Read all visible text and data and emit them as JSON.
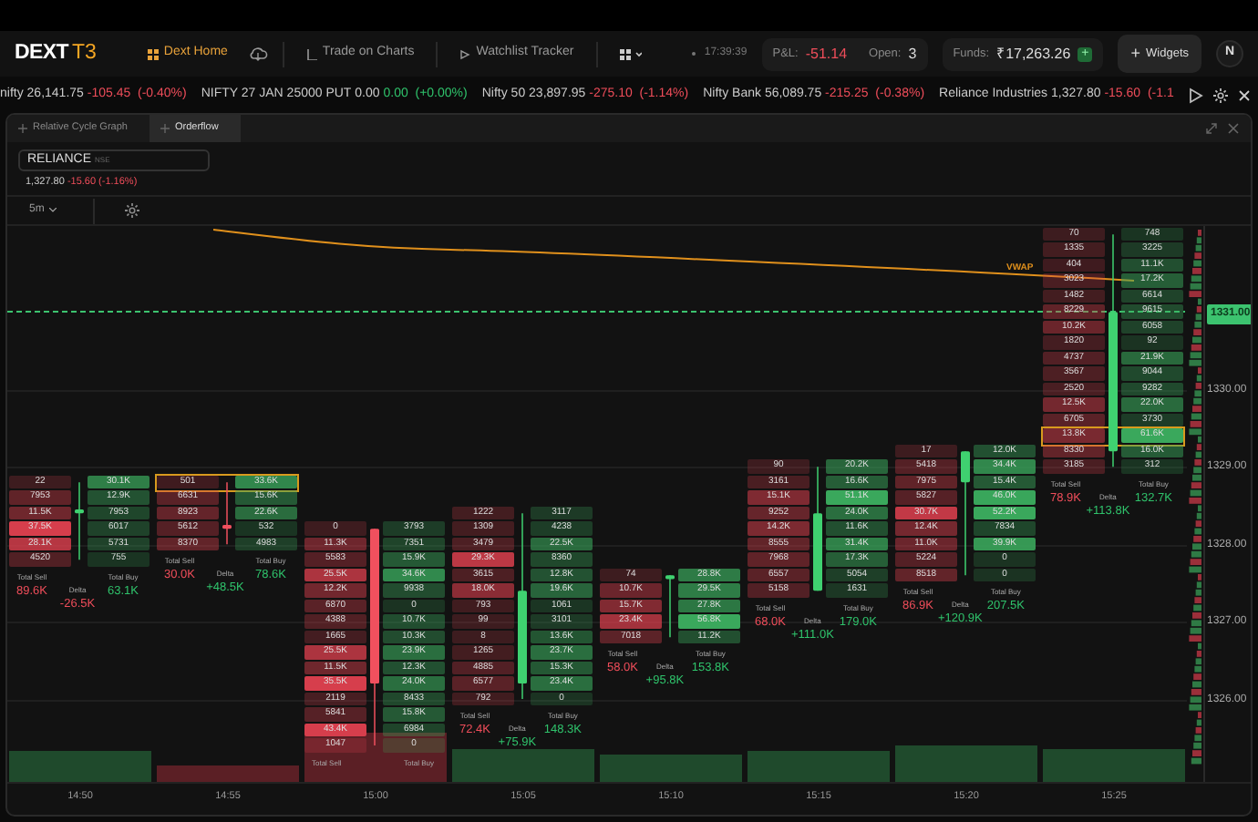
{
  "header": {
    "logo_main": "DEXT",
    "logo_sub": "T3",
    "nav": [
      {
        "label": "Dext Home",
        "selected": true
      },
      {
        "label": "Trade on Charts",
        "selected": false
      },
      {
        "label": "Watchlist Tracker",
        "selected": false
      }
    ],
    "clock": "17:39:39",
    "pnl_label": "P&L:",
    "pnl": "-51.14",
    "open_label": "Open:",
    "open": "3",
    "funds_label": "Funds:",
    "funds": "₹17,263.26",
    "add_funds": "+",
    "widgets_icon": "+",
    "widgets": "Widgets",
    "avatar": "N"
  },
  "ticker": [
    {
      "name": "nifty",
      "price": "26,141.75",
      "change": "-105.45",
      "percent": "(-0.40%)",
      "negative": true
    },
    {
      "name": "NIFTY 27 JAN 25000 PUT",
      "price": "0.00",
      "change": "0.00",
      "percent": "(+0.00%)",
      "negative": false
    },
    {
      "name": "Nifty 50",
      "price": "23,897.95",
      "change": "-275.10",
      "percent": "(-1.14%)",
      "negative": true
    },
    {
      "name": "Nifty Bank",
      "price": "56,089.75",
      "change": "-215.25",
      "percent": "(-0.38%)",
      "negative": true
    },
    {
      "name": "Reliance Industries",
      "price": "1,327.80",
      "change": "-15.60",
      "percent": "(-1.1",
      "negative": true
    }
  ],
  "panel": {
    "tabs": [
      {
        "label": "Relative Cycle Graph",
        "selected": false
      },
      {
        "label": "Orderflow",
        "selected": true
      }
    ],
    "symbol": "RELIANCE",
    "exchange": "NSE",
    "price": "1,327.80",
    "change": "-15.60",
    "percent": "(-1.16%)",
    "negative": true,
    "interval": "5m"
  },
  "chart": {
    "vwap_label": "VWAP",
    "last_price": "1331.00",
    "chart_data": {
      "type": "candlestick",
      "grid": true,
      "categories": [
        "14:50",
        "14:55",
        "15:00",
        "15:05",
        "15:10",
        "15:15",
        "15:20",
        "15:25"
      ],
      "ohlc": [
        [
          1328.4,
          1328.8,
          1327.8,
          1328.45
        ],
        [
          1328.25,
          1328.8,
          1328.0,
          1328.2
        ],
        [
          1328.2,
          1328.2,
          1325.4,
          1326.2
        ],
        [
          1326.2,
          1328.4,
          1326.0,
          1327.4
        ],
        [
          1327.55,
          1327.6,
          1326.8,
          1327.6
        ],
        [
          1327.4,
          1329.0,
          1327.4,
          1328.4
        ],
        [
          1328.8,
          1329.2,
          1327.6,
          1329.2
        ],
        [
          1329.2,
          1332.0,
          1329.0,
          1331.0
        ]
      ],
      "ylim": [
        1324.93,
        1332.11
      ],
      "yticks": [
        {
          "value": 1330,
          "label": "1330.00"
        },
        {
          "value": 1329,
          "label": "1329.00"
        },
        {
          "value": 1328,
          "label": "1328.00"
        },
        {
          "value": 1327,
          "label": "1327.00"
        },
        {
          "value": 1326,
          "label": "1326.00"
        }
      ]
    },
    "columns": [
      {
        "rows": [
          {
            "sell": "22",
            "buy": "30.1K",
            "poc": false
          },
          {
            "sell": "7953",
            "buy": "12.9K",
            "poc": false
          },
          {
            "sell": "11.5K",
            "buy": "7953",
            "poc": false
          },
          {
            "sell": "37.5K",
            "buy": "6017",
            "poc": false
          },
          {
            "sell": "28.1K",
            "buy": "5731",
            "poc": false
          },
          {
            "sell": "4520",
            "buy": "755",
            "poc": false
          }
        ],
        "total_sell_label": "Total Sell",
        "total_sell": "89.6K",
        "total_buy_label": "Total Buy",
        "total_buy": "63.1K",
        "delta_label": "Delta",
        "delta": "-26.5K",
        "delta_negative": true,
        "volume": {
          "bullish": true
        }
      },
      {
        "rows": [
          {
            "sell": "501",
            "buy": "33.6K",
            "poc": true
          },
          {
            "sell": "6631",
            "buy": "15.6K",
            "poc": false
          },
          {
            "sell": "8923",
            "buy": "22.6K",
            "poc": false
          },
          {
            "sell": "5612",
            "buy": "532",
            "poc": false
          },
          {
            "sell": "8370",
            "buy": "4983",
            "poc": false
          }
        ],
        "total_sell_label": "Total Sell",
        "total_sell": "30.0K",
        "total_buy_label": "Total Buy",
        "total_buy": "78.6K",
        "delta_label": "Delta",
        "delta": "+48.5K",
        "delta_negative": false,
        "volume": {
          "bullish": false
        }
      },
      {
        "rows": [
          {
            "sell": "0",
            "buy": "3793",
            "poc": false
          },
          {
            "sell": "11.3K",
            "buy": "7351",
            "poc": false
          },
          {
            "sell": "5583",
            "buy": "15.9K",
            "poc": false
          },
          {
            "sell": "25.5K",
            "buy": "34.6K",
            "poc": false
          },
          {
            "sell": "12.2K",
            "buy": "9938",
            "poc": false
          },
          {
            "sell": "6870",
            "buy": "0",
            "poc": false
          },
          {
            "sell": "4388",
            "buy": "10.7K",
            "poc": false
          },
          {
            "sell": "1665",
            "buy": "10.3K",
            "poc": false
          },
          {
            "sell": "25.5K",
            "buy": "23.9K",
            "poc": false
          },
          {
            "sell": "11.5K",
            "buy": "12.3K",
            "poc": false
          },
          {
            "sell": "35.5K",
            "buy": "24.0K",
            "poc": false
          },
          {
            "sell": "2119",
            "buy": "8433",
            "poc": false
          },
          {
            "sell": "5841",
            "buy": "15.8K",
            "poc": false
          },
          {
            "sell": "43.4K",
            "buy": "6984",
            "poc": false
          },
          {
            "sell": "1047",
            "buy": "0",
            "poc": false
          }
        ],
        "total_sell_label": "Total Sell",
        "total_buy_label": "Total Buy",
        "volume": {
          "bullish": false
        }
      },
      {
        "rows": [
          {
            "sell": "1222",
            "buy": "3117",
            "poc": false
          },
          {
            "sell": "1309",
            "buy": "4238",
            "poc": false
          },
          {
            "sell": "3479",
            "buy": "22.5K",
            "poc": false
          },
          {
            "sell": "29.3K",
            "buy": "8360",
            "poc": false
          },
          {
            "sell": "3615",
            "buy": "12.8K",
            "poc": false
          },
          {
            "sell": "18.0K",
            "buy": "19.6K",
            "poc": false
          },
          {
            "sell": "793",
            "buy": "1061",
            "poc": false
          },
          {
            "sell": "99",
            "buy": "3101",
            "poc": false
          },
          {
            "sell": "8",
            "buy": "13.6K",
            "poc": false
          },
          {
            "sell": "1265",
            "buy": "23.7K",
            "poc": false
          },
          {
            "sell": "4885",
            "buy": "15.3K",
            "poc": false
          },
          {
            "sell": "6577",
            "buy": "23.4K",
            "poc": false
          },
          {
            "sell": "792",
            "buy": "0",
            "poc": false
          }
        ],
        "total_sell_label": "Total Sell",
        "total_sell": "72.4K",
        "total_buy_label": "Total Buy",
        "total_buy": "148.3K",
        "delta_label": "Delta",
        "delta": "+75.9K",
        "delta_negative": false,
        "volume": {
          "bullish": true
        }
      },
      {
        "rows": [
          {
            "sell": "74",
            "buy": "28.8K",
            "poc": false
          },
          {
            "sell": "10.7K",
            "buy": "29.5K",
            "poc": false
          },
          {
            "sell": "15.7K",
            "buy": "27.8K",
            "poc": false
          },
          {
            "sell": "23.4K",
            "buy": "56.8K",
            "poc": false
          },
          {
            "sell": "7018",
            "buy": "11.2K",
            "poc": false
          }
        ],
        "total_sell_label": "Total Sell",
        "total_sell": "58.0K",
        "total_buy_label": "Total Buy",
        "total_buy": "153.8K",
        "delta_label": "Delta",
        "delta": "+95.8K",
        "delta_negative": false,
        "volume": {
          "bullish": true
        }
      },
      {
        "rows": [
          {
            "sell": "90",
            "buy": "20.2K",
            "poc": false
          },
          {
            "sell": "3161",
            "buy": "16.6K",
            "poc": false
          },
          {
            "sell": "15.1K",
            "buy": "51.1K",
            "poc": false
          },
          {
            "sell": "9252",
            "buy": "24.0K",
            "poc": false
          },
          {
            "sell": "14.2K",
            "buy": "11.6K",
            "poc": false
          },
          {
            "sell": "8555",
            "buy": "31.4K",
            "poc": false
          },
          {
            "sell": "7968",
            "buy": "17.3K",
            "poc": false
          },
          {
            "sell": "6557",
            "buy": "5054",
            "poc": false
          },
          {
            "sell": "5158",
            "buy": "1631",
            "poc": false
          }
        ],
        "total_sell_label": "Total Sell",
        "total_sell": "68.0K",
        "total_buy_label": "Total Buy",
        "total_buy": "179.0K",
        "delta_label": "Delta",
        "delta": "+111.0K",
        "delta_negative": false,
        "volume": {
          "bullish": true
        }
      },
      {
        "rows": [
          {
            "sell": "17",
            "buy": "12.0K",
            "poc": false
          },
          {
            "sell": "5418",
            "buy": "34.4K",
            "poc": false
          },
          {
            "sell": "7975",
            "buy": "15.4K",
            "poc": false
          },
          {
            "sell": "5827",
            "buy": "46.0K",
            "poc": false
          },
          {
            "sell": "30.7K",
            "buy": "52.2K",
            "poc": false
          },
          {
            "sell": "12.4K",
            "buy": "7834",
            "poc": false
          },
          {
            "sell": "11.0K",
            "buy": "39.9K",
            "poc": false
          },
          {
            "sell": "5224",
            "buy": "0",
            "poc": false
          },
          {
            "sell": "8518",
            "buy": "0",
            "poc": false
          }
        ],
        "total_sell_label": "Total Sell",
        "total_sell": "86.9K",
        "total_buy_label": "Total Buy",
        "total_buy": "207.5K",
        "delta_label": "Delta",
        "delta": "+120.9K",
        "delta_negative": false,
        "volume": {
          "bullish": true
        }
      },
      {
        "rows": [
          {
            "sell": "70",
            "buy": "748",
            "poc": false
          },
          {
            "sell": "1335",
            "buy": "3225",
            "poc": false
          },
          {
            "sell": "404",
            "buy": "11.1K",
            "poc": false
          },
          {
            "sell": "3023",
            "buy": "17.2K",
            "poc": false
          },
          {
            "sell": "1482",
            "buy": "6614",
            "poc": false
          },
          {
            "sell": "8229",
            "buy": "9615",
            "poc": false
          },
          {
            "sell": "10.2K",
            "buy": "6058",
            "poc": false
          },
          {
            "sell": "1820",
            "buy": "92",
            "poc": false
          },
          {
            "sell": "4737",
            "buy": "21.9K",
            "poc": false
          },
          {
            "sell": "3567",
            "buy": "9044",
            "poc": false
          },
          {
            "sell": "2520",
            "buy": "9282",
            "poc": false
          },
          {
            "sell": "12.5K",
            "buy": "22.0K",
            "poc": false
          },
          {
            "sell": "6705",
            "buy": "3730",
            "poc": false
          },
          {
            "sell": "13.8K",
            "buy": "61.6K",
            "poc": true
          },
          {
            "sell": "8330",
            "buy": "16.0K",
            "poc": false
          },
          {
            "sell": "3185",
            "buy": "312",
            "poc": false
          }
        ],
        "total_sell_label": "Total Sell",
        "total_sell": "78.9K",
        "total_buy_label": "Total Buy",
        "total_buy": "132.7K",
        "delta_label": "Delta",
        "delta": "+113.8K",
        "delta_negative": false,
        "volume": {
          "bullish": true
        }
      }
    ]
  }
}
